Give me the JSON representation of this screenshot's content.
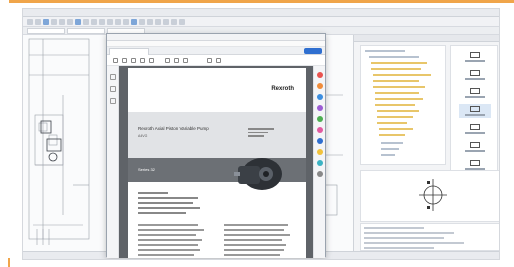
{
  "pdf": {
    "brand": "Rexroth",
    "band_title": "Rexroth Axial Piston Variable Pump",
    "band_sub": "A4VG",
    "dark_band_text": "Series 32"
  },
  "colors": {
    "accent_orange": "#f0a54a",
    "pdf_sign_blue": "#2f6fd0"
  },
  "icons": {
    "pdf_side_tools": [
      "search-icon",
      "comment-icon",
      "pen-icon",
      "shape-icon",
      "color-icon",
      "stamp-icon",
      "share-icon",
      "print-icon",
      "zoom-icon",
      "more-icon"
    ]
  }
}
